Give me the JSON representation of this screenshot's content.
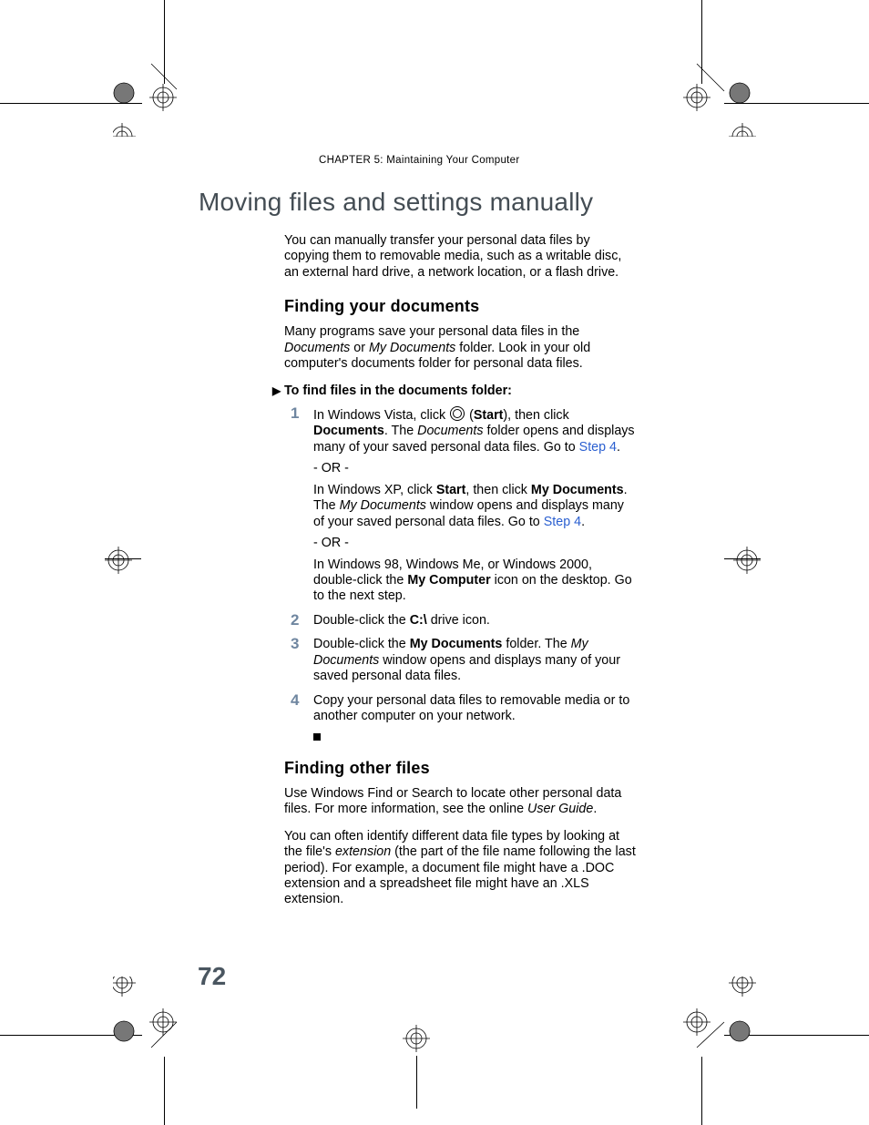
{
  "header": {
    "chapter_label": "CHAPTER",
    "chapter_number": "5",
    "chapter_sep": ":",
    "chapter_title": "Maintaining Your Computer"
  },
  "h1": "Moving files and settings manually",
  "intro": "You can manually transfer your personal data files by copying them to removable media, such as a writable disc, an external hard drive, a network location, or a flash drive.",
  "section1": {
    "heading": "Finding your documents",
    "intro_a": "Many programs save your personal data files in the ",
    "intro_docs": "Documents",
    "intro_or": " or ",
    "intro_mydocs": "My Documents",
    "intro_b": " folder. Look in your old computer's documents folder for personal data files.",
    "proc_head": "To find files in the documents folder:",
    "steps": {
      "s1": {
        "a": "In Windows Vista, click ",
        "start_paren_open": " (",
        "start_bold": "Start",
        "start_paren_close": "), then click ",
        "documents_bold": "Documents",
        "b": ". The ",
        "documents_italic": "Documents",
        "c": " folder opens and displays many of your saved personal data files. Go to ",
        "link1": "Step 4",
        "d": ".",
        "or1": "- OR -",
        "xp_a": "In Windows XP, click ",
        "xp_start": "Start",
        "xp_b": ", then click ",
        "xp_mydocs": "My Documents",
        "xp_c": ". The ",
        "xp_mydocs_italic": "My Documents",
        "xp_d": " window opens and displays many of your saved personal data files. Go to ",
        "link2": "Step 4",
        "xp_e": ".",
        "or2": "- OR -",
        "w98_a": "In Windows 98, Windows Me, or Windows 2000, double-click the ",
        "w98_mycomp": "My Computer",
        "w98_b": " icon on the desktop. Go to the next step."
      },
      "s2": {
        "a": "Double-click the ",
        "cdrive": "C:\\",
        "b": " drive icon."
      },
      "s3": {
        "a": "Double-click the ",
        "mydocs_bold": "My Documents",
        "b": " folder. The ",
        "mydocs_italic": "My Documents",
        "c": " window opens and displays many of your saved personal data files."
      },
      "s4": {
        "a": "Copy your personal data files to removable media or to another computer on your network."
      }
    }
  },
  "section2": {
    "heading": "Finding other files",
    "p1_a": "Use Windows Find or Search to locate other personal data files. For more information, see the online ",
    "p1_ug": "User Guide",
    "p1_b": ".",
    "p2_a": "You can often identify different data file types by looking at the file's ",
    "p2_ext": "extension",
    "p2_b": " (the part of the file name following the last period). For example, a document file might have a .DOC extension and a spreadsheet file might have an .XLS extension."
  },
  "page_number": "72"
}
